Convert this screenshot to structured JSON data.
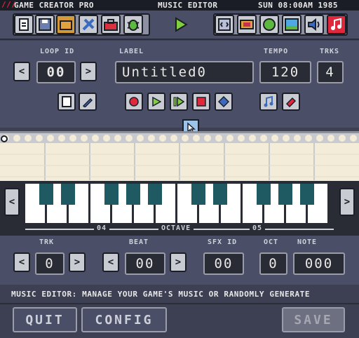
{
  "titlebar": {
    "app_name": "GAME CREATOR PRO",
    "mode": "MUSIC EDITOR",
    "clock": "SUN 08:00AM 1985"
  },
  "toolbar": {
    "left_icons": [
      "file-icon",
      "save-disk-icon",
      "folder-icon",
      "tools-icon",
      "toolbox-icon",
      "bug-icon"
    ],
    "play_icon": "play-icon",
    "right_icons": [
      "code-icon",
      "sprite-icon",
      "map-icon",
      "picture-icon",
      "speaker-icon",
      "music-note-icon"
    ]
  },
  "loop": {
    "label": "LOOP ID",
    "value": "00",
    "prev": "<",
    "next": ">"
  },
  "name": {
    "label": "LABEL",
    "value": "Untitled0"
  },
  "tempo": {
    "label": "TEMPO",
    "value": "120"
  },
  "tracks": {
    "label": "TRKS",
    "value": "4"
  },
  "octave": {
    "label": "OCTAVE",
    "low": "04",
    "high": "05",
    "prev": "<",
    "next": ">"
  },
  "track": {
    "label": "TRK",
    "value": "0",
    "prev": "<",
    "next": ">"
  },
  "beat": {
    "label": "BEAT",
    "value": "00",
    "prev": "<",
    "next": ">"
  },
  "sfx": {
    "label": "SFX ID",
    "value": "00"
  },
  "oct": {
    "label": "OCT",
    "value": "0"
  },
  "note": {
    "label": "NOTE",
    "value": "000"
  },
  "status": "MUSIC EDITOR: MANAGE YOUR GAME'S MUSIC OR RANDOMLY GENERATE",
  "footer": {
    "quit": "QUIT",
    "config": "CONFIG",
    "save": "SAVE"
  },
  "colors": {
    "accent_red": "#e0283c",
    "accent_green": "#4caf3c",
    "black_key": "#1f5a63"
  }
}
